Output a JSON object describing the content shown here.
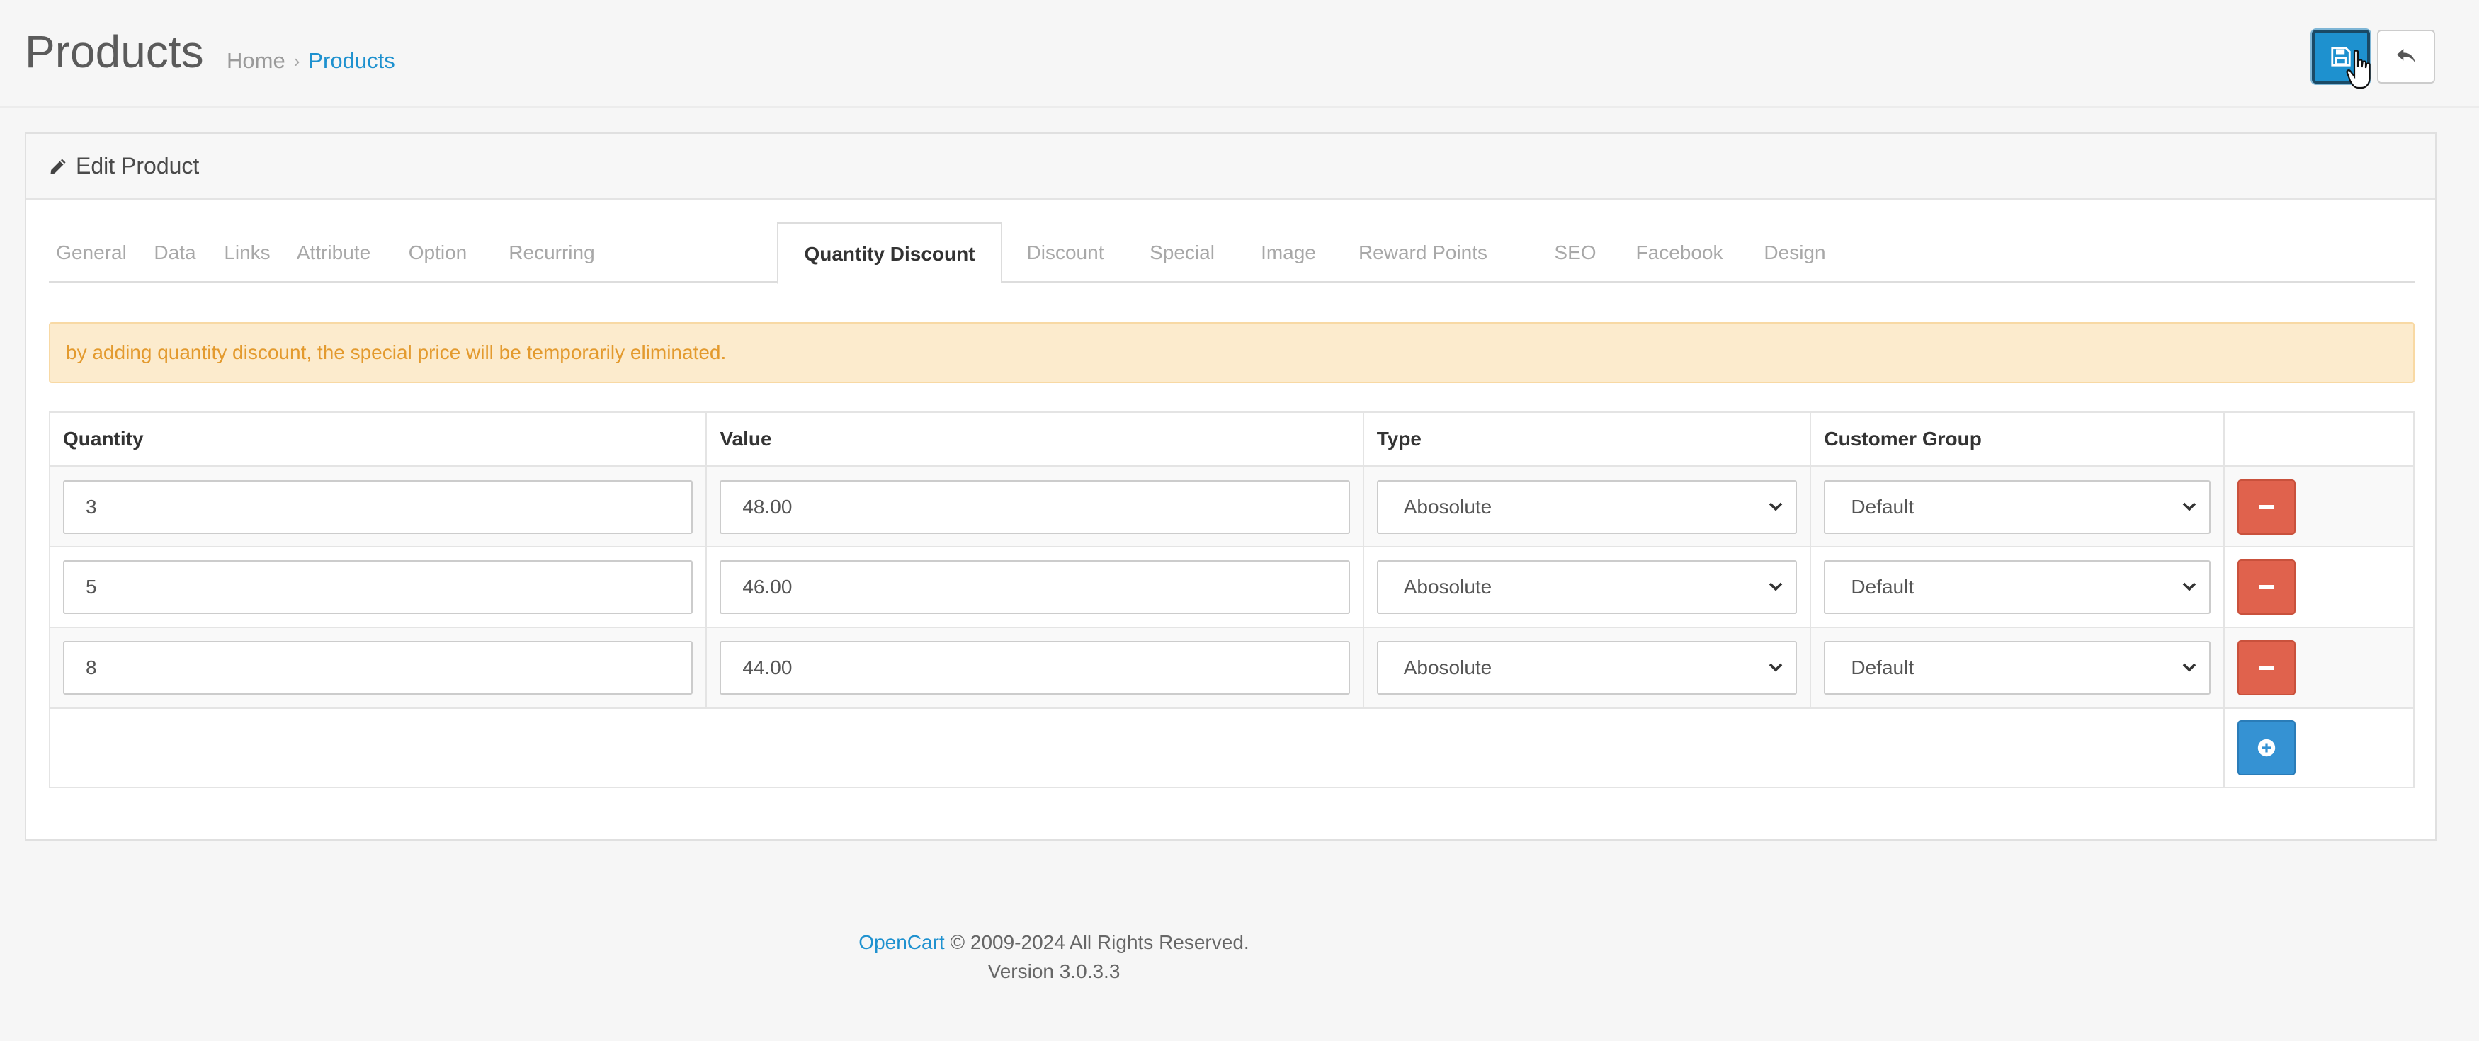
{
  "header": {
    "title": "Products",
    "breadcrumb": [
      "Home",
      "Products"
    ],
    "save_icon": "save-icon",
    "back_icon": "reply-icon"
  },
  "panel": {
    "heading": "Edit Product",
    "heading_icon": "pencil-icon"
  },
  "tabs": [
    {
      "label": "General"
    },
    {
      "label": "Data"
    },
    {
      "label": "Links"
    },
    {
      "label": "Attribute"
    },
    {
      "label": "Option"
    },
    {
      "label": "Recurring"
    },
    {
      "label": "Quantity Discount",
      "active": true
    },
    {
      "label": "Discount"
    },
    {
      "label": "Special"
    },
    {
      "label": "Image"
    },
    {
      "label": "Reward Points"
    },
    {
      "label": "SEO"
    },
    {
      "label": "Facebook"
    },
    {
      "label": "Design"
    }
  ],
  "alert": {
    "text": "by adding quantity discount, the special price will be temporarily eliminated."
  },
  "table": {
    "headers": [
      "Quantity",
      "Value",
      "Type",
      "Customer Group",
      ""
    ],
    "rows": [
      {
        "quantity": "3",
        "value": "48.00",
        "type": "Abosolute",
        "group": "Default"
      },
      {
        "quantity": "5",
        "value": "46.00",
        "type": "Abosolute",
        "group": "Default"
      },
      {
        "quantity": "8",
        "value": "44.00",
        "type": "Abosolute",
        "group": "Default"
      }
    ]
  },
  "footer": {
    "brand": "OpenCart",
    "copyright": " © 2009-2024 All Rights Reserved.",
    "version": "Version 3.0.3.3"
  },
  "colors": {
    "primary": "#1e91cf",
    "danger": "#e0624d",
    "warning_bg": "#fcebcd",
    "warning_text": "#e39a2e"
  }
}
